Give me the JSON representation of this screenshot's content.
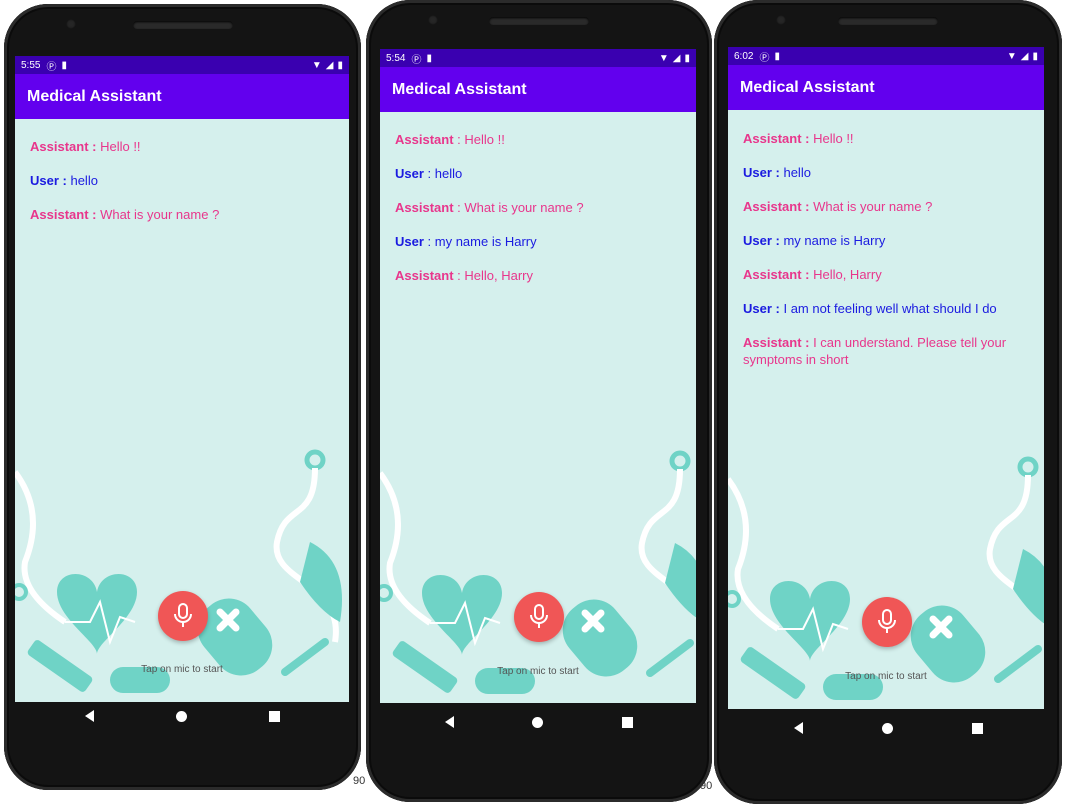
{
  "phones": [
    {
      "status_time": "5:55",
      "app_title": "Medical Assistant",
      "messages": [
        {
          "speaker": "Assistant :",
          "text": " Hello !!",
          "role": "assistant"
        },
        {
          "speaker": "User :",
          "text": " hello",
          "role": "user"
        },
        {
          "speaker": "Assistant :",
          "text": " What is your name ?",
          "role": "assistant"
        }
      ],
      "mic_hint": "Tap on mic to start"
    },
    {
      "status_time": "5:54",
      "app_title": "Medical Assistant",
      "messages": [
        {
          "speaker": "Assistant",
          "text": " : Hello !!",
          "role": "assistant"
        },
        {
          "speaker": "User",
          "text": " : hello",
          "role": "user"
        },
        {
          "speaker": "Assistant",
          "text": " : What is your name ?",
          "role": "assistant"
        },
        {
          "speaker": "User",
          "text": " : my name is Harry",
          "role": "user"
        },
        {
          "speaker": "Assistant",
          "text": " : Hello, Harry",
          "role": "assistant"
        }
      ],
      "mic_hint": "Tap on mic to start"
    },
    {
      "status_time": "6:02",
      "app_title": "Medical Assistant",
      "messages": [
        {
          "speaker": "Assistant :",
          "text": " Hello !!",
          "role": "assistant"
        },
        {
          "speaker": "User :",
          "text": " hello",
          "role": "user"
        },
        {
          "speaker": "Assistant :",
          "text": " What is your name ?",
          "role": "assistant"
        },
        {
          "speaker": "User :",
          "text": " my name is Harry",
          "role": "user"
        },
        {
          "speaker": "Assistant :",
          "text": " Hello, Harry",
          "role": "assistant"
        },
        {
          "speaker": "User :",
          "text": " I am not feeling well what should I do",
          "role": "user"
        },
        {
          "speaker": "Assistant :",
          "text": " I can understand. Please tell your symptoms in short",
          "role": "assistant"
        }
      ],
      "mic_hint": "Tap on mic to start"
    }
  ],
  "edge_labels": [
    "90",
    "90"
  ],
  "colors": {
    "app_bar": "#6200ee",
    "status_bar": "#3a00b0",
    "assistant_text": "#e8368c",
    "user_text": "#1b1be0",
    "mic_button": "#f05656",
    "screen_bg": "#d5f0ed",
    "decoration": "#6fd3c6"
  },
  "icons": {
    "status_left": [
      "p-notification-icon",
      "sd-card-icon"
    ],
    "status_right": [
      "wifi-icon",
      "signal-icon",
      "battery-icon"
    ],
    "mic": "microphone-icon",
    "nav": [
      "back-icon",
      "home-icon",
      "recents-icon"
    ]
  }
}
